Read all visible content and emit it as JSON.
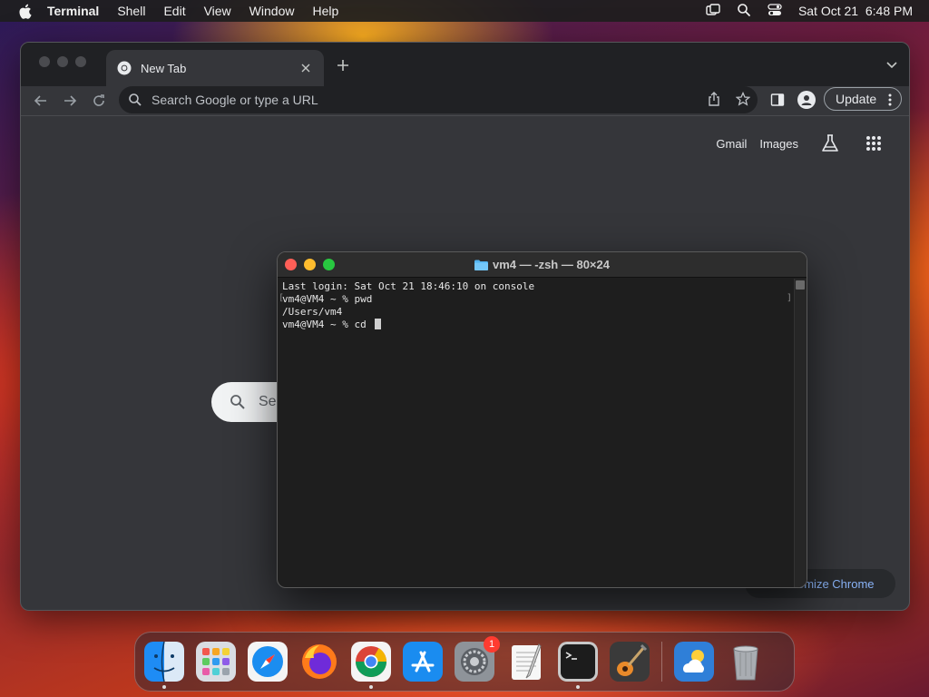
{
  "menubar": {
    "app_name": "Terminal",
    "items": [
      "Shell",
      "Edit",
      "View",
      "Window",
      "Help"
    ],
    "datetime": "Sat Oct 21  6:48 PM",
    "icons": [
      "apple-icon",
      "screen-mirroring-icon",
      "spotlight-search-icon",
      "control-center-icon"
    ]
  },
  "chrome": {
    "tab_title": "New Tab",
    "omnibox_placeholder": "Search Google or type a URL",
    "update_label": "Update",
    "ntp_links": {
      "gmail": "Gmail",
      "images": "Images"
    },
    "search_box_text": "Sea",
    "customize_label": "omize Chrome"
  },
  "terminal": {
    "title": "vm4 — -zsh — 80×24",
    "lines": [
      "Last login: Sat Oct 21 18:46:10 on console",
      "vm4@VM4 ~ % pwd",
      "/Users/vm4",
      "vm4@VM4 ~ % cd "
    ]
  },
  "dock": {
    "items": [
      {
        "name": "finder",
        "running": true
      },
      {
        "name": "launchpad",
        "running": false
      },
      {
        "name": "safari",
        "running": false
      },
      {
        "name": "firefox",
        "running": false
      },
      {
        "name": "chrome",
        "running": true
      },
      {
        "name": "app-store",
        "running": false
      },
      {
        "name": "system-settings",
        "running": false,
        "badge": "1"
      },
      {
        "name": "textedit",
        "running": false
      },
      {
        "name": "terminal",
        "running": true
      },
      {
        "name": "garageband",
        "running": false
      },
      {
        "name": "weather",
        "running": false
      },
      {
        "name": "trash",
        "running": false
      }
    ]
  },
  "colors": {
    "traffic_red": "#ff5f57",
    "traffic_yellow": "#febc2e",
    "traffic_green": "#28c840",
    "chrome_bg": "#35363a",
    "terminal_bg": "#1e1e1e",
    "link_blue": "#8ab4f8"
  }
}
